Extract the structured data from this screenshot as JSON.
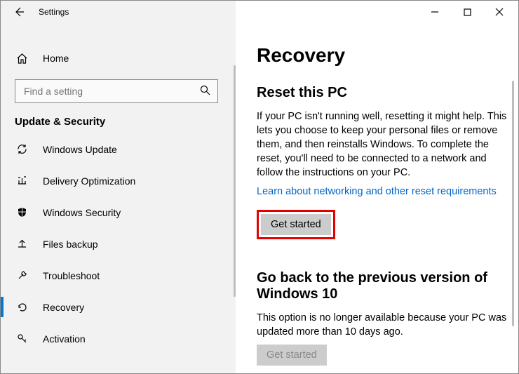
{
  "app": {
    "title": "Settings"
  },
  "sidebar": {
    "home": "Home",
    "search_placeholder": "Find a setting",
    "category": "Update & Security",
    "items": [
      {
        "label": "Windows Update"
      },
      {
        "label": "Delivery Optimization"
      },
      {
        "label": "Windows Security"
      },
      {
        "label": "Files backup"
      },
      {
        "label": "Troubleshoot"
      },
      {
        "label": "Recovery"
      },
      {
        "label": "Activation"
      }
    ]
  },
  "content": {
    "title": "Recovery",
    "reset": {
      "heading": "Reset this PC",
      "body": "If your PC isn't running well, resetting it might help. This lets you choose to keep your personal files or remove them, and then reinstalls Windows. To complete the reset, you'll need to be connected to a network and follow the instructions on your PC.",
      "link": "Learn about networking and other reset requirements",
      "button": "Get started"
    },
    "goback": {
      "heading": "Go back to the previous version of Windows 10",
      "body": "This option is no longer available because your PC was updated more than 10 days ago.",
      "button": "Get started"
    }
  }
}
